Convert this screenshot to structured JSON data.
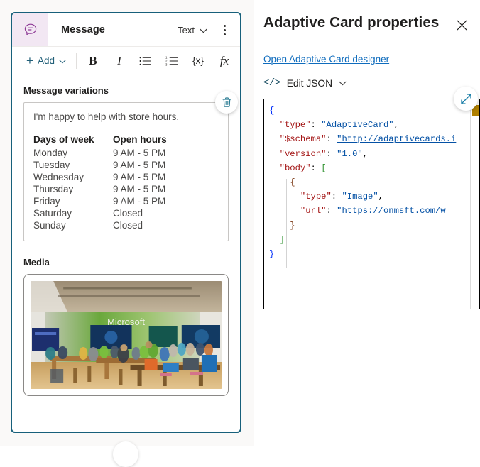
{
  "node": {
    "icon": "message-bubble-icon",
    "title": "Message",
    "type_selector": {
      "value": "Text",
      "chevron": "chevron-down-icon"
    },
    "more_menu": "more-options-icon",
    "toolbar": {
      "add_label": "Add",
      "add_plus": "+",
      "add_chevron": "chevron-down-icon",
      "bold": "B",
      "italic": "I",
      "bulleted_list": "bulleted-list-icon",
      "numbered_list": "numbered-list-icon",
      "variable": "{x}",
      "formula": "fx"
    },
    "sections": {
      "variations_label": "Message variations",
      "media_label": "Media"
    },
    "delete_button": "delete-icon",
    "variation": {
      "intro": "I'm happy to help with store hours.",
      "table": {
        "headers": [
          "Days of week",
          "Open hours"
        ],
        "rows": [
          [
            "Monday",
            "9 AM - 5 PM"
          ],
          [
            "Tuesday",
            "9 AM - 5 PM"
          ],
          [
            "Wednesday",
            "9 AM - 5 PM"
          ],
          [
            "Thursday",
            "9 AM - 5 PM"
          ],
          [
            "Friday",
            "9 AM - 5 PM"
          ],
          [
            "Saturday",
            "Closed"
          ],
          [
            "Sunday",
            "Closed"
          ]
        ]
      }
    },
    "media": {
      "image_alt": "Microsoft Store interior with customers at tables",
      "image_sign_text": "Microsoft"
    }
  },
  "properties_panel": {
    "title": "Adaptive Card properties",
    "close_label": "✕",
    "designer_link": "Open Adaptive Card designer",
    "edit_json": {
      "code_glyph": "</>",
      "label": "Edit JSON",
      "chevron": "chevron-down-icon"
    },
    "expand_button": "expand-icon",
    "json_lines": [
      "{",
      "    \"type\": \"AdaptiveCard\",",
      "    \"$schema\": \"http://adaptivecards.io/schemas/adaptive-card.json\",",
      "    \"version\": \"1.0\",",
      "    \"body\": [",
      "        {",
      "            \"type\": \"Image\",",
      "            \"url\": \"https://onmsft.com/wp-content/uploads/store.jpg\"",
      "        }",
      "    ]",
      "}"
    ]
  },
  "colors": {
    "node_border": "#17607b",
    "node_icon_bg": "#f2e7f3",
    "node_icon_fg": "#8e3a96",
    "accent_link": "#0f6cbd",
    "teal": "#1b6b85",
    "json_key": "#a31515",
    "json_string": "#0451a5",
    "bracket_1": "#0431fa",
    "bracket_2": "#319331",
    "bracket_3": "#7b3814",
    "minimap_mark": "#b08000"
  }
}
